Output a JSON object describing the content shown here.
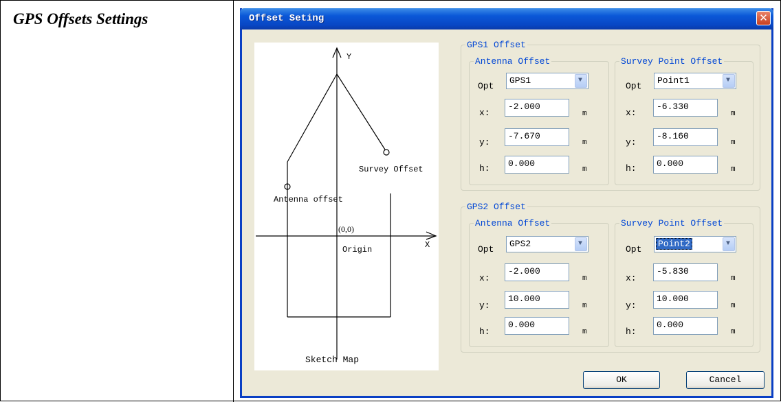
{
  "doc": {
    "section_label": "GPS Offsets Settings"
  },
  "dialog": {
    "title": "Offset Seting",
    "close_glyph": "✕",
    "ok_label": "OK",
    "cancel_label": "Cancel"
  },
  "sketch": {
    "caption": "Sketch Map",
    "axis_y": "Y",
    "axis_x": "X",
    "origin_coord": "(0,0)",
    "origin_label": "Origin",
    "antenna_label": "Antenna offset",
    "survey_label": "Survey Offset"
  },
  "labels": {
    "opt": "Opt",
    "x": "x:",
    "y": "y:",
    "h": "h:",
    "unit": "m"
  },
  "gps1": {
    "legend": "GPS1 Offset",
    "antenna": {
      "legend": "Antenna Offset",
      "opt": "GPS1",
      "x": "-2.000",
      "y": "-7.670",
      "h": "0.000"
    },
    "survey": {
      "legend": "Survey Point Offset",
      "opt": "Point1",
      "x": "-6.330",
      "y": "-8.160",
      "h": "0.000"
    }
  },
  "gps2": {
    "legend": "GPS2 Offset",
    "antenna": {
      "legend": "Antenna Offset",
      "opt": "GPS2",
      "x": "-2.000",
      "y": "10.000",
      "h": "0.000"
    },
    "survey": {
      "legend": "Survey Point Offset",
      "opt": "Point2",
      "x": "-5.830",
      "y": "10.000",
      "h": "0.000"
    }
  },
  "icons": {
    "dropdown": "chevron-down-icon",
    "close": "close-icon"
  }
}
